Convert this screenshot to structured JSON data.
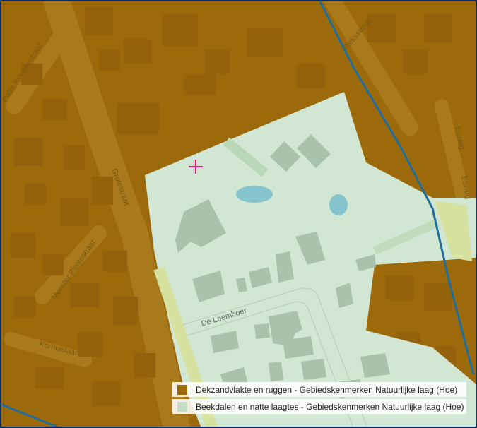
{
  "map": {
    "marker": "crosshair-marker",
    "streets": [
      "Pater Rouppestraat",
      "Grotestraat",
      "Meester Pleijtestraat",
      "Korhuislaan",
      "De Leemboer",
      "Pieksstraat",
      "Esweg"
    ]
  },
  "legend": {
    "items": [
      {
        "label": "Dekzandvlakte en ruggen - Gebiedskenmerken Natuurlijke laag (Hoe)",
        "color": "#9c6a0a"
      },
      {
        "label": "Beekdalen en natte laagtes - Gebiedskenmerken Natuurlijke laag (Hoe)",
        "color": "#c5dcc6"
      }
    ]
  },
  "colors": {
    "dekzand": "#9c6a0a",
    "beekdal": "#d2e7d3",
    "building": "#a9c2ab",
    "water": "#85c4cc",
    "stream": "#1f6e9e",
    "marker": "#e0197a",
    "frame": "#0d2d5c"
  }
}
